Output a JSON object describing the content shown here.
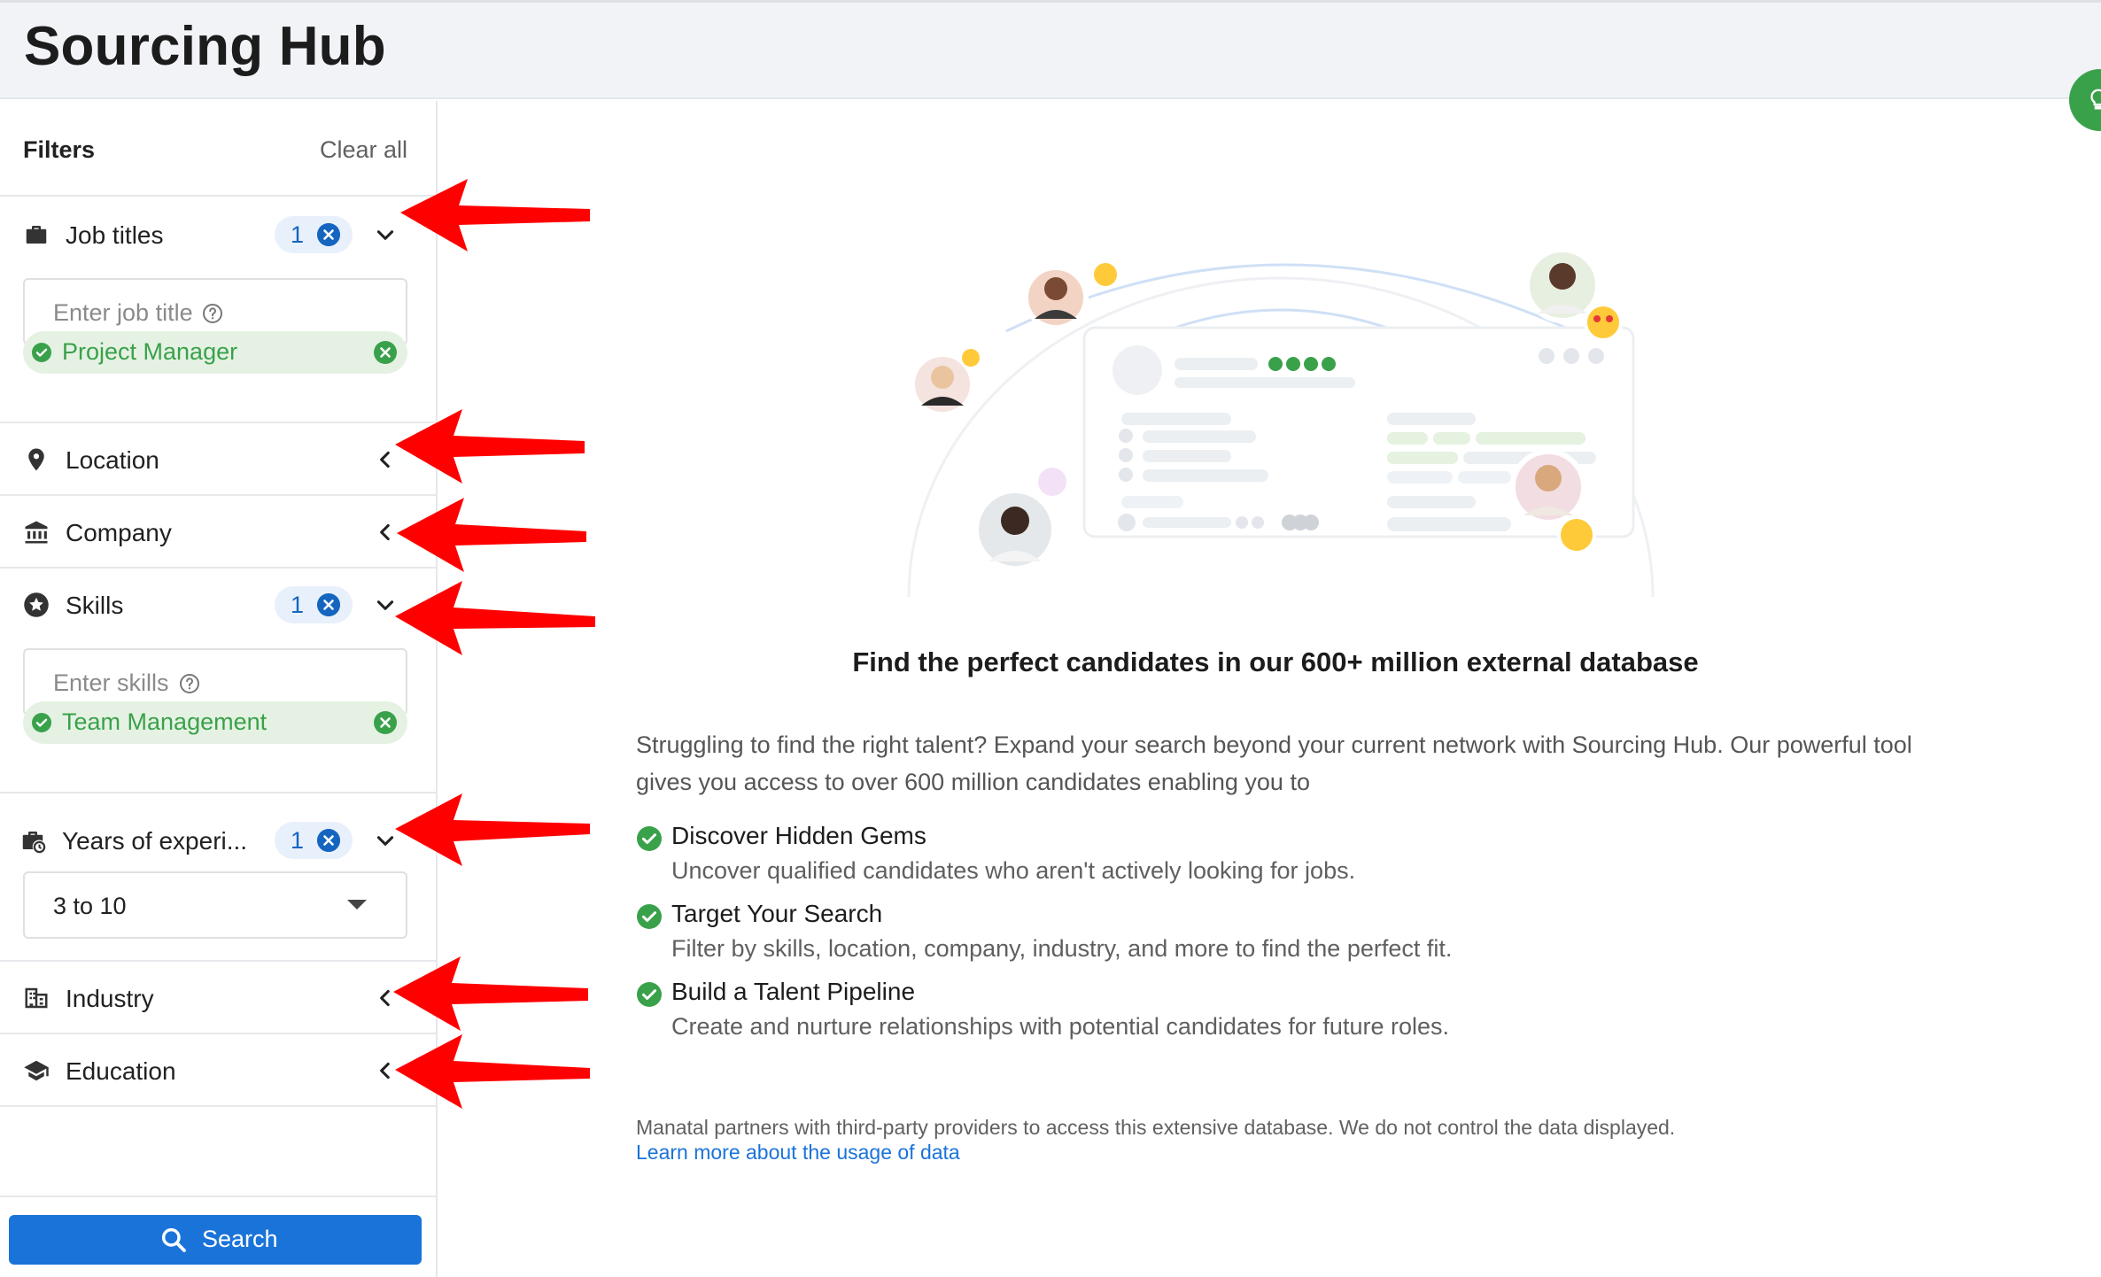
{
  "header": {
    "title": "Sourcing Hub"
  },
  "filters": {
    "title": "Filters",
    "clear_all": "Clear all"
  },
  "sections": {
    "job_titles": {
      "label": "Job titles",
      "count": "1",
      "placeholder": "Enter job title",
      "chip": "Project Manager"
    },
    "location": {
      "label": "Location"
    },
    "company": {
      "label": "Company"
    },
    "skills": {
      "label": "Skills",
      "count": "1",
      "placeholder": "Enter skills",
      "chip": "Team Management"
    },
    "experience": {
      "label": "Years of experi...",
      "count": "1",
      "selected": "3 to 10"
    },
    "industry": {
      "label": "Industry"
    },
    "education": {
      "label": "Education"
    }
  },
  "search_button": "Search",
  "main": {
    "headline": "Find the perfect candidates in our 600+ million external database",
    "intro": "Struggling to find the right talent? Expand your search beyond your current network with Sourcing Hub. Our powerful tool gives you access to over 600 million candidates enabling you to",
    "benefits": [
      {
        "title": "Discover Hidden Gems",
        "desc": "Uncover qualified candidates who aren't actively looking for jobs."
      },
      {
        "title": "Target Your Search",
        "desc": "Filter by skills, location, company, industry, and more to find the perfect fit."
      },
      {
        "title": "Build a Talent Pipeline",
        "desc": "Create and nurture relationships with potential candidates for future roles."
      }
    ],
    "disclaimer": "Manatal partners with third-party providers to access this extensive database. We do not control the data displayed.",
    "learn_more": "Learn more about the usage of data"
  },
  "colors": {
    "accent": "#1a73d9",
    "success": "#3aa14b",
    "arrow": "#ff0000"
  }
}
